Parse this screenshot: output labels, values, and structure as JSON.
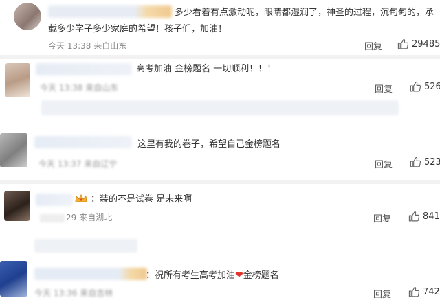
{
  "comments": [
    {
      "text_line1": "多少看着有点激动呢，眼睛都湿润了，神圣的过程，沉甸甸的，承",
      "text_line2": "载多少学子多少家庭的希望！孩子们，加油！",
      "time": "今天 13:38 来自山东",
      "reply_label": "回复",
      "likes": "29485"
    },
    {
      "text": "高考加油 金榜题名 一切顺利！！！",
      "time": "今天 13:38 来自山东",
      "reply_label": "回复",
      "likes": "526"
    },
    {
      "text": "这里有我的卷子，希望自己金榜题名",
      "time": "今天 13:37 来自辽宁",
      "reply_label": "回复",
      "likes": "523"
    },
    {
      "text": "装的不是试卷 是未来啊",
      "time": "29 来自湖北",
      "reply_label": "回复",
      "likes": "841"
    },
    {
      "text_before_heart": "祝所有考生高考加油",
      "text_after_heart": "金榜题名",
      "time": "今天 13:36 来自吉林",
      "reply_label": "回复",
      "likes": "742"
    }
  ],
  "colors": {
    "divider": "#f2f2f2",
    "heart": "#e0352b",
    "meta": "#888888"
  },
  "icons": {
    "like": "thumbs-up-icon",
    "heart": "heart-icon",
    "crown": "vip-crown-icon"
  }
}
